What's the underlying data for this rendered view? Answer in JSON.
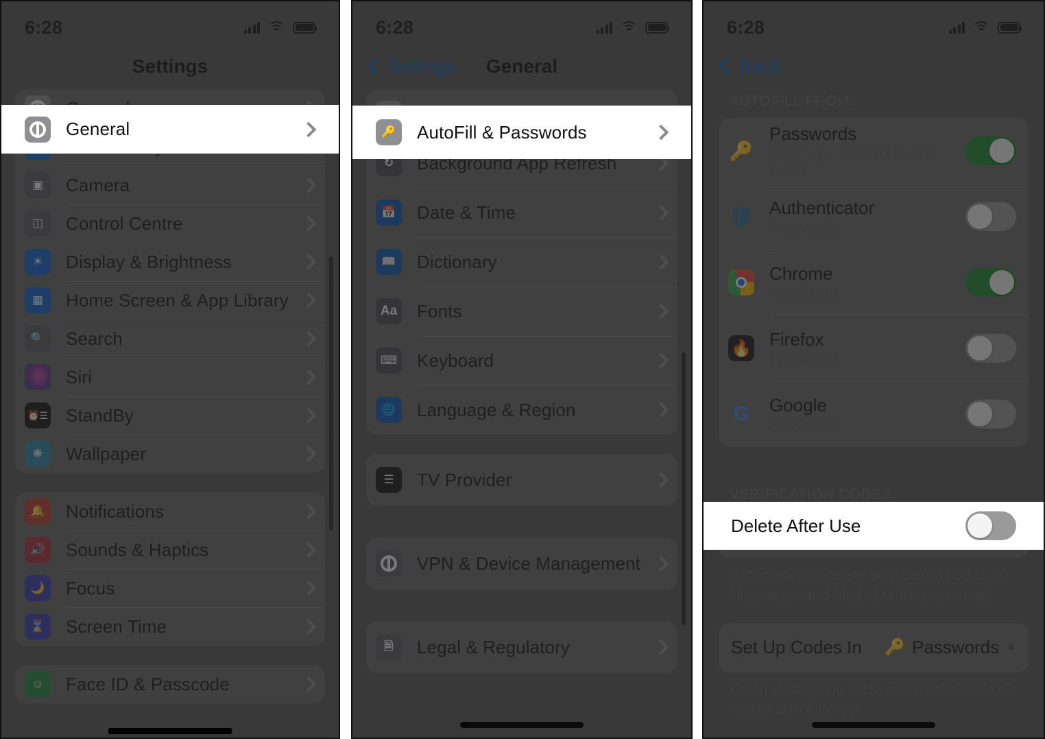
{
  "status_bar": {
    "time": "6:28",
    "signal_icon": "cellular-bars-icon",
    "wifi_icon": "wifi-icon",
    "battery_icon": "battery-icon"
  },
  "panel1": {
    "nav": {
      "title": "Settings"
    },
    "highlighted_row": "General",
    "groups": [
      {
        "rows": [
          {
            "label": "General",
            "icon": "gear-icon",
            "color": "#8e8e93"
          },
          {
            "label": "Accessibility",
            "icon": "accessibility-icon",
            "color": "#0a62d0"
          },
          {
            "label": "Camera",
            "icon": "camera-icon",
            "color": "#5b5b60"
          },
          {
            "label": "Control Centre",
            "icon": "control-centre-icon",
            "color": "#5b5b60"
          },
          {
            "label": "Display & Brightness",
            "icon": "brightness-icon",
            "color": "#0a62d0"
          },
          {
            "label": "Home Screen & App Library",
            "icon": "home-screen-icon",
            "color": "#0a62d0"
          },
          {
            "label": "Search",
            "icon": "search-icon",
            "color": "#5b5b60"
          },
          {
            "label": "Siri",
            "icon": "siri-icon",
            "color": "#3a2b52"
          },
          {
            "label": "StandBy",
            "icon": "standby-icon",
            "color": "#111111"
          },
          {
            "label": "Wallpaper",
            "icon": "wallpaper-icon",
            "color": "#2f86a8"
          }
        ]
      },
      {
        "rows": [
          {
            "label": "Notifications",
            "icon": "bell-icon",
            "color": "#c0392b"
          },
          {
            "label": "Sounds & Haptics",
            "icon": "speaker-icon",
            "color": "#b02a3a"
          },
          {
            "label": "Focus",
            "icon": "moon-icon",
            "color": "#3b3bb5"
          },
          {
            "label": "Screen Time",
            "icon": "hourglass-icon",
            "color": "#3b3bb5"
          }
        ]
      },
      {
        "rows": [
          {
            "label": "Face ID & Passcode",
            "icon": "face-id-icon",
            "color": "#1d8a43"
          }
        ]
      }
    ]
  },
  "panel2": {
    "nav": {
      "back_label": "Settings",
      "title": "General"
    },
    "highlighted_row": "AutoFill & Passwords",
    "groups": [
      {
        "rows": [
          {
            "label": "AutoFill & Passwords",
            "icon": "key-icon",
            "color": "#8e8e93"
          },
          {
            "label": "Background App Refresh",
            "icon": "refresh-icon",
            "color": "#4a4a4f"
          },
          {
            "label": "Date & Time",
            "icon": "calendar-clock-icon",
            "color": "#0a55b8"
          },
          {
            "label": "Dictionary",
            "icon": "book-icon",
            "color": "#0a55b8"
          },
          {
            "label": "Fonts",
            "icon": "fonts-icon",
            "color": "#4a4a4f"
          },
          {
            "label": "Keyboard",
            "icon": "keyboard-icon",
            "color": "#4a4a4f"
          },
          {
            "label": "Language & Region",
            "icon": "globe-icon",
            "color": "#0a55b8"
          }
        ]
      },
      {
        "rows": [
          {
            "label": "TV Provider",
            "icon": "tv-provider-icon",
            "color": "#111111"
          }
        ]
      },
      {
        "rows": [
          {
            "label": "VPN & Device Management",
            "icon": "gear-icon",
            "color": "#5b5b60"
          }
        ]
      },
      {
        "rows": [
          {
            "label": "Legal & Regulatory",
            "icon": "legal-icon",
            "color": "#5b5b60"
          }
        ]
      }
    ]
  },
  "panel3": {
    "nav": {
      "back_label": "Back"
    },
    "highlighted_row": "Delete After Use",
    "section_autofill_header": "AUTOFILL FROM:",
    "autofill_sources": [
      {
        "title": "Passwords",
        "subtitle": "Passkeys, passwords and codes",
        "icon": "passwords-keys-icon",
        "enabled": true
      },
      {
        "title": "Authenticator",
        "subtitle": "Passwords",
        "icon": "authenticator-icon",
        "enabled": false
      },
      {
        "title": "Chrome",
        "subtitle": "Passwords",
        "icon": "chrome-icon",
        "enabled": true
      },
      {
        "title": "Firefox",
        "subtitle": "Passwords",
        "icon": "firefox-icon",
        "enabled": false
      },
      {
        "title": "Google",
        "subtitle": "Passwords",
        "icon": "google-icon",
        "enabled": false
      }
    ],
    "section_verification_header": "VERIFICATION CODES",
    "delete_after_use": {
      "label": "Delete After Use",
      "enabled": false
    },
    "delete_after_use_footnote": "Automatically delete verification codes in Messages and Mail after they are used.",
    "set_up_codes": {
      "label": "Set Up Codes In",
      "value": "Passwords",
      "icon": "passwords-keys-icon"
    },
    "set_up_codes_footnote": "Open verification code setup links and QR codes with this app."
  }
}
